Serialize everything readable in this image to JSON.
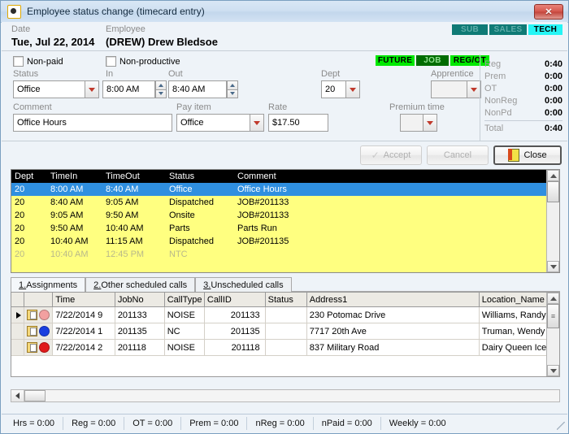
{
  "window": {
    "title": "Employee status change (timecard entry)",
    "close_label": "✕"
  },
  "header": {
    "date_label": "Date",
    "date_value": "Tue, Jul 22, 2014",
    "employee_label": "Employee",
    "employee_value": "(DREW) Drew Bledsoe",
    "badges": [
      {
        "text": "SUB",
        "state": "inactive"
      },
      {
        "text": "SALES",
        "state": "inactive"
      },
      {
        "text": "TECH",
        "state": "active"
      }
    ]
  },
  "form": {
    "nonpaid_label": "Non-paid",
    "nonproductive_label": "Non-productive",
    "status_label": "Status",
    "status_value": "Office",
    "in_label": "In",
    "in_value": "8:00 AM",
    "out_label": "Out",
    "out_value": "8:40 AM",
    "dept_label": "Dept",
    "dept_value": "20",
    "apprentice_label": "Apprentice",
    "apprentice_value": "",
    "comment_label": "Comment",
    "comment_value": "Office Hours",
    "payitem_label": "Pay item",
    "payitem_value": "Office",
    "rate_label": "Rate",
    "rate_value": "$17.50",
    "premium_label": "Premium time",
    "premium_value": "",
    "flags": [
      {
        "text": "FUTURE",
        "style": "future"
      },
      {
        "text": "JOB",
        "style": "job"
      },
      {
        "text": "REG/OT",
        "style": "regot"
      }
    ]
  },
  "totals": [
    {
      "label": "Reg",
      "value": "0:40"
    },
    {
      "label": "Prem",
      "value": "0:00"
    },
    {
      "label": "OT",
      "value": "0:00"
    },
    {
      "label": "NonReg",
      "value": "0:00"
    },
    {
      "label": "NonPd",
      "value": "0:00"
    }
  ],
  "totals_final": {
    "label": "Total",
    "value": "0:40"
  },
  "buttons": {
    "accept": "Accept",
    "cancel": "Cancel",
    "close": "Close"
  },
  "timecard_grid": {
    "columns": [
      "Dept",
      "TimeIn",
      "TimeOut",
      "Status",
      "Comment"
    ],
    "rows": [
      {
        "dept": "20",
        "timein": "8:00 AM",
        "timeout": "8:40 AM",
        "status": "Office",
        "comment": "Office Hours",
        "state": "selected"
      },
      {
        "dept": "20",
        "timein": "8:40 AM",
        "timeout": "9:05 AM",
        "status": "Dispatched",
        "comment": "JOB#201133",
        "state": "normal"
      },
      {
        "dept": "20",
        "timein": "9:05 AM",
        "timeout": "9:50 AM",
        "status": "Onsite",
        "comment": "JOB#201133",
        "state": "normal"
      },
      {
        "dept": "20",
        "timein": "9:50 AM",
        "timeout": "10:40 AM",
        "status": "Parts",
        "comment": "Parts Run",
        "state": "normal"
      },
      {
        "dept": "20",
        "timein": "10:40 AM",
        "timeout": "11:15 AM",
        "status": "Dispatched",
        "comment": "JOB#201135",
        "state": "normal"
      },
      {
        "dept": "20",
        "timein": "10:40 AM",
        "timeout": "12:45 PM",
        "status": "NTC",
        "comment": "",
        "state": "dim"
      }
    ]
  },
  "tabs": [
    {
      "num": "1.",
      "label": " Assignments",
      "active": true
    },
    {
      "num": "2.",
      "label": " Other scheduled calls",
      "active": false
    },
    {
      "num": "3.",
      "label": " Unscheduled calls",
      "active": false
    }
  ],
  "calls_grid": {
    "columns": [
      "",
      "",
      "Time",
      "JobNo",
      "CallType",
      "CallID",
      "Status",
      "Address1",
      "Location_Name"
    ],
    "rows": [
      {
        "marker": "▶",
        "dot": "#f2a0a0",
        "time": "7/22/2014 9",
        "jobno": "201133",
        "calltype": "NOISE",
        "callid": "201133",
        "status": "",
        "address": "230 Potomac Drive",
        "location": "Williams, Randy"
      },
      {
        "marker": "",
        "dot": "#1a3fe0",
        "time": "7/22/2014 1",
        "jobno": "201135",
        "calltype": "NC",
        "callid": "201135",
        "status": "",
        "address": "7717 20th Ave",
        "location": "Truman, Wendy"
      },
      {
        "marker": "",
        "dot": "#e01a1a",
        "time": "7/22/2014 2",
        "jobno": "201118",
        "calltype": "NOISE",
        "callid": "201118",
        "status": "",
        "address": "837 Military Road",
        "location": "Dairy Queen Ice Cr"
      }
    ]
  },
  "statusbar": [
    "Hrs = 0:00",
    "Reg = 0:00",
    "OT = 0:00",
    "Prem = 0:00",
    "nReg = 0:00",
    "nPaid = 0:00",
    "Weekly = 0:00"
  ]
}
